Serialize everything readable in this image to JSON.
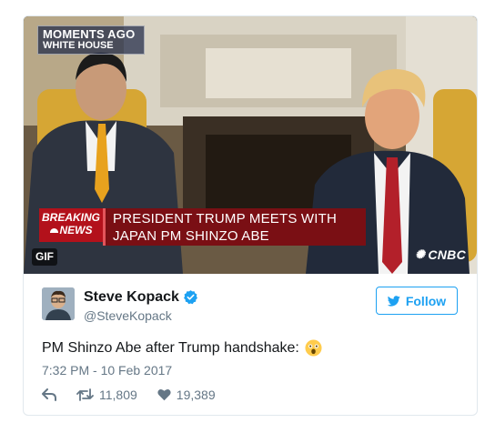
{
  "media": {
    "overlay_top": {
      "line1": "MOMENTS AGO",
      "line2": "WHITE HOUSE"
    },
    "breaking": {
      "line1": "BREAKING",
      "line2": "NEWS"
    },
    "headline": {
      "line1": "PRESIDENT TRUMP MEETS WITH",
      "line2": "JAPAN PM SHINZO ABE"
    },
    "gif_badge": "GIF",
    "network": "CNBC"
  },
  "tweet": {
    "author_name": "Steve Kopack",
    "handle": "@SteveKopack",
    "follow_label": "Follow",
    "text": "PM Shinzo Abe after Trump handshake:",
    "timestamp": "7:32 PM - 10 Feb 2017",
    "retweets": "11,809",
    "likes": "19,389"
  },
  "colors": {
    "twitter_blue": "#1da1f2",
    "muted_text": "#657786",
    "breaking_red": "#b3111b",
    "headline_red": "#7a0f14"
  },
  "icons": [
    "reply-icon",
    "retweet-icon",
    "like-icon",
    "verified-icon",
    "twitter-bird-icon",
    "astonished-emoji-icon"
  ]
}
